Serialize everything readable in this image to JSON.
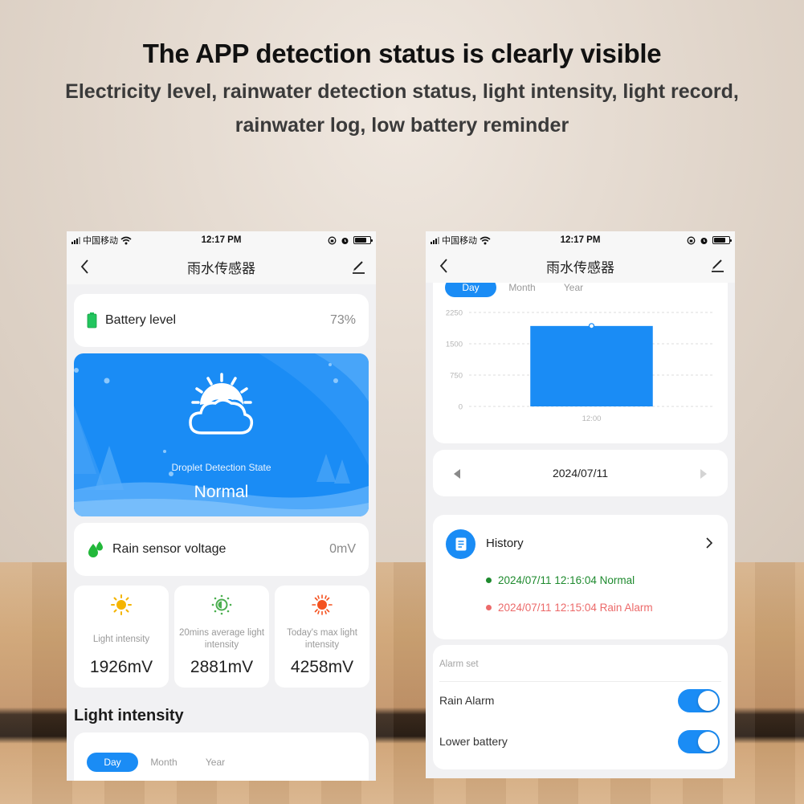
{
  "banner": {
    "headline": "The APP detection status is clearly visible",
    "subline_1": "Electricity level, rainwater detection status, light intensity, light record,",
    "subline_2": "rainwater log, low battery reminder"
  },
  "status_bar": {
    "carrier": "中国移动",
    "time": "12:17 PM",
    "battery_level_fraction": 0.75,
    "icons": [
      "signal-icon",
      "wifi-icon",
      "orientation-lock-icon",
      "alarm-icon",
      "battery-icon"
    ]
  },
  "nav": {
    "title": "雨水传感器",
    "back_icon": "chevron-left-icon",
    "edit_icon": "pencil-icon"
  },
  "left_screen": {
    "battery": {
      "label": "Battery level",
      "value": "73%",
      "icon": "battery-icon",
      "color": "#22c55e"
    },
    "detection": {
      "label": "Droplet Detection State",
      "value": "Normal",
      "icon": "sun-cloud-icon",
      "bg_color": "#1a8cf5"
    },
    "rain_voltage": {
      "label": "Rain sensor voltage",
      "value": "0mV",
      "icon": "droplets-icon",
      "color": "#22b83a"
    },
    "stats": [
      {
        "label": "Light intensity",
        "value": "1926mV",
        "icon": "sun-icon",
        "color": "#f4b400"
      },
      {
        "label": "20mins average light intensity",
        "value": "2881mV",
        "icon": "half-sun-icon",
        "color": "#4caf50"
      },
      {
        "label": "Today's max light intensity",
        "value": "4258mV",
        "icon": "sun-bright-icon",
        "color": "#f4511e"
      }
    ],
    "section_title": "Light intensity",
    "tabs": [
      {
        "label": "Day",
        "active": true
      },
      {
        "label": "Month",
        "active": false
      },
      {
        "label": "Year",
        "active": false
      }
    ]
  },
  "right_screen": {
    "tabs": [
      {
        "label": "Day",
        "active": true
      },
      {
        "label": "Month",
        "active": false
      },
      {
        "label": "Year",
        "active": false
      }
    ],
    "date_selector": {
      "date": "2024/07/11",
      "prev_icon": "triangle-left-icon",
      "next_icon": "triangle-right-icon"
    },
    "history": {
      "title": "History",
      "icon": "document-icon",
      "entries": [
        {
          "text": "2024/07/11 12:16:04 Normal",
          "color": "#1e8a2e"
        },
        {
          "text": "2024/07/11 12:15:04 Rain Alarm",
          "color": "#ec6a6a"
        }
      ]
    },
    "alarm_set": {
      "title": "Alarm set",
      "items": [
        {
          "label": "Rain Alarm",
          "enabled": true
        },
        {
          "label": "Lower battery",
          "enabled": true
        }
      ]
    }
  },
  "chart_data": {
    "type": "bar",
    "title": "",
    "xlabel": "",
    "ylabel": "",
    "categories": [
      "12:00"
    ],
    "values": [
      1926
    ],
    "yticks": [
      0,
      750,
      1500,
      2250
    ],
    "ylim": [
      0,
      2250
    ],
    "grid": true,
    "color": "#1a8cf5"
  }
}
